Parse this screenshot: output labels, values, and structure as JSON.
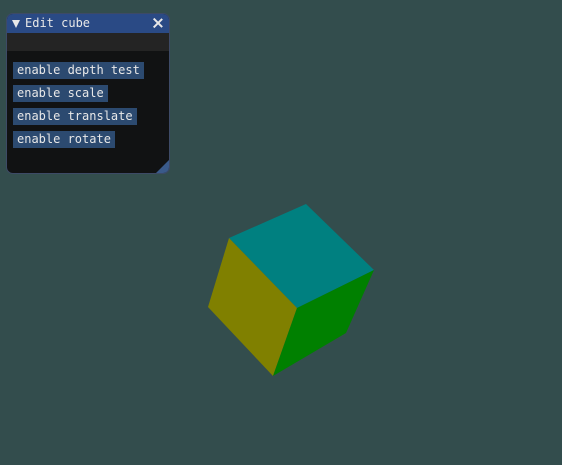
{
  "window": {
    "title": "Edit cube",
    "buttons": [
      "enable depth test",
      "enable scale",
      "enable translate",
      "enable rotate"
    ]
  },
  "icons": {
    "collapse": "collapse-triangle-icon",
    "close": "close-x-icon",
    "resize": "resize-grip-icon"
  },
  "colors": {
    "background": "#334d4d",
    "cube_top": "#008080",
    "cube_left": "#808000",
    "cube_right": "#008000",
    "title_bar": "#2a4a85",
    "button": "#2c4a70"
  }
}
